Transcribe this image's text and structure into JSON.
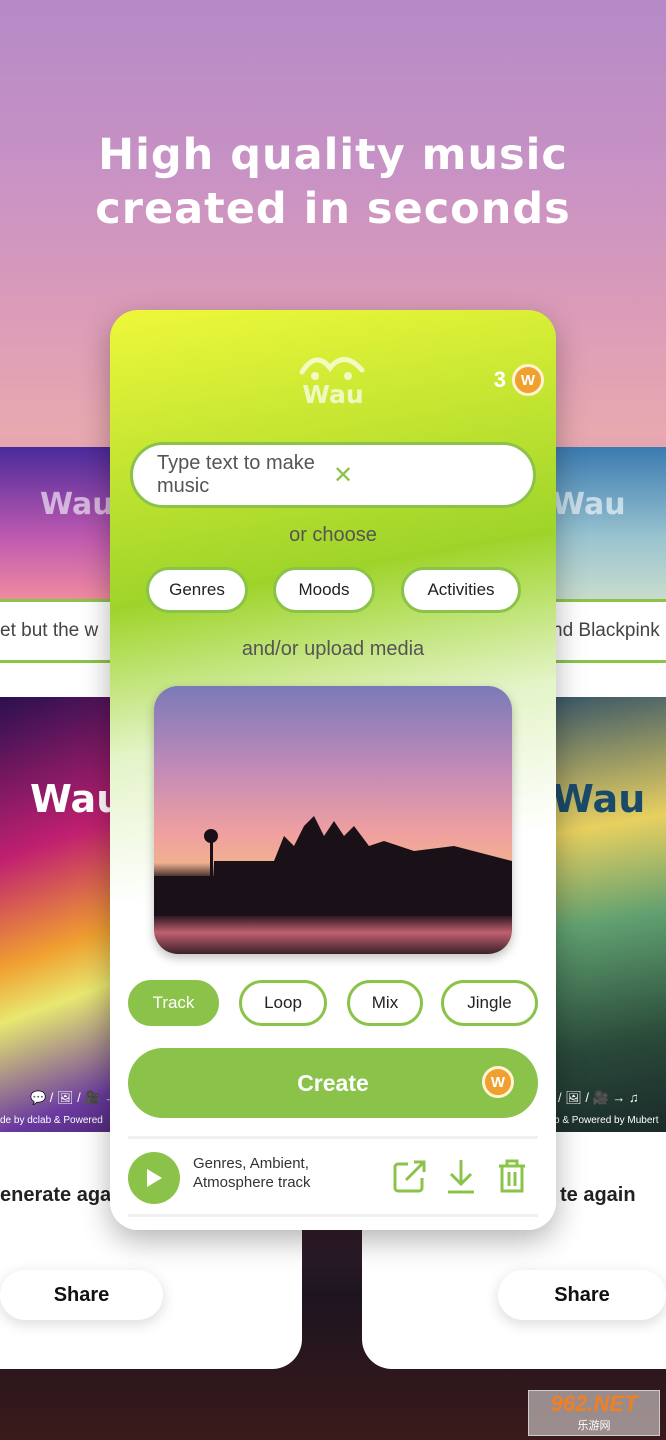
{
  "headline": {
    "line1": "High quality music",
    "line2": "created in seconds"
  },
  "brand": {
    "logo_text": "Wau",
    "accent": "#8bc34a",
    "coin_color": "#f0a030",
    "coin_letter": "W"
  },
  "left_card": {
    "prompt": "et but the w",
    "credit_icons": "💬 / 🖼 / 🎥 →",
    "credit": "de by dclab & Powered",
    "regenerate": "enerate aga",
    "share": "Share"
  },
  "right_card": {
    "prompt": "nd Blackpink",
    "credit_icons": "/ 🖼 / 🎥 → ♫",
    "credit": "b & Powered by Mubert",
    "regenerate": "te again",
    "share": "Share"
  },
  "main": {
    "credits": "3",
    "input": {
      "placeholder": "Type text to make music",
      "clear": "✕"
    },
    "or_choose": "or choose",
    "categories": [
      "Genres",
      "Moods",
      "Activities"
    ],
    "upload_label": "and/or upload media",
    "types": [
      {
        "label": "Track",
        "selected": true
      },
      {
        "label": "Loop",
        "selected": false
      },
      {
        "label": "Mix",
        "selected": false
      },
      {
        "label": "Jingle",
        "selected": false
      }
    ],
    "create": "Create",
    "track": {
      "line1": "Genres, Ambient,",
      "line2": "Atmosphere track"
    }
  },
  "watermark": {
    "text": "962.NET",
    "sub": "乐游网"
  }
}
